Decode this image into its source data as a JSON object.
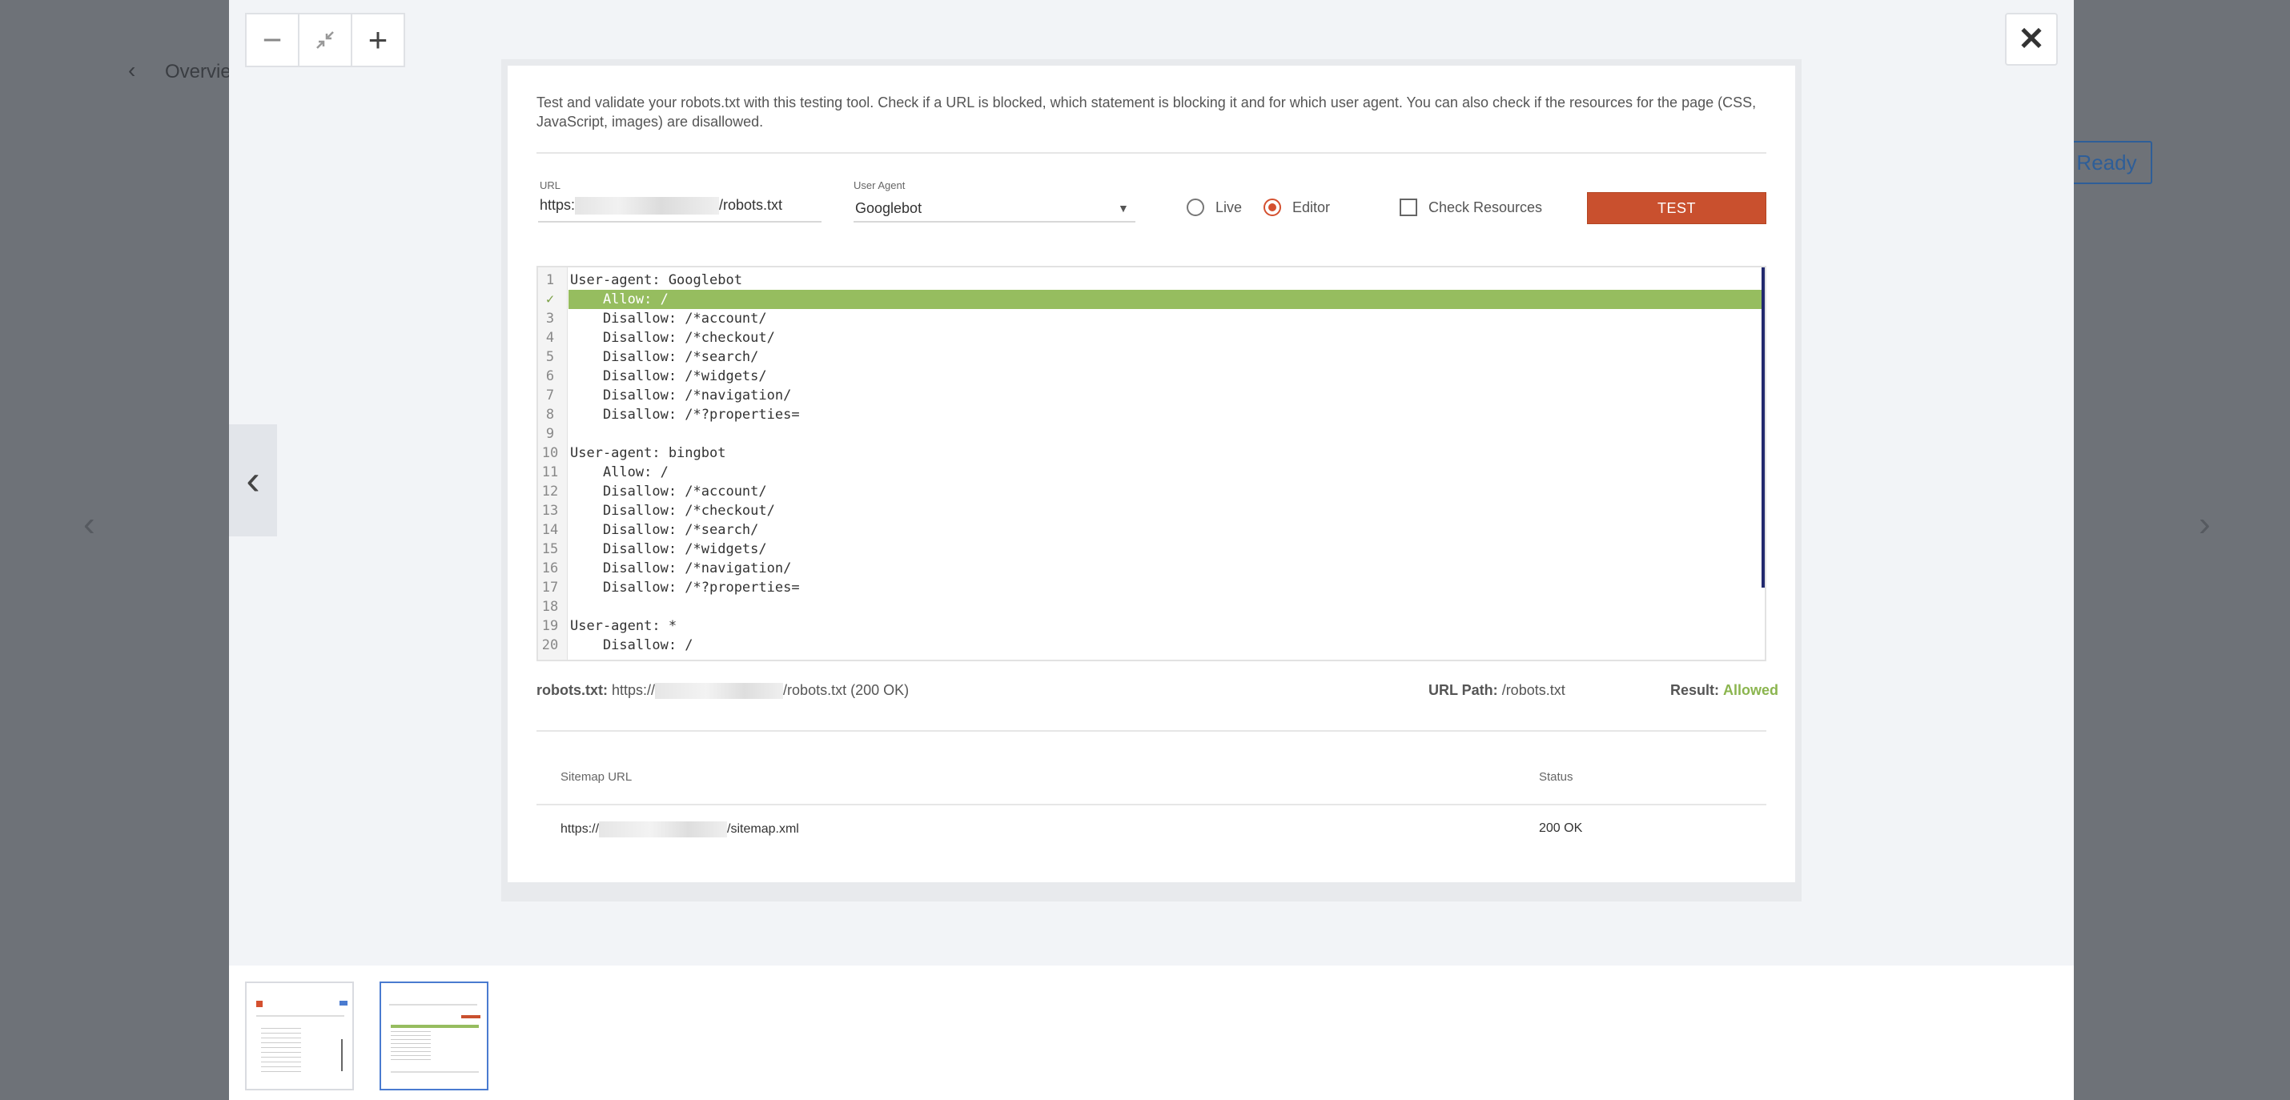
{
  "background": {
    "back_label": "Overvie",
    "status_badge": "Ready"
  },
  "toolbar": {
    "zoom_out_icon": "minus-icon",
    "fit_icon": "compress-icon",
    "zoom_in_icon": "plus-icon",
    "close_icon": "close-icon",
    "prev_icon": "chevron-left-icon"
  },
  "tool": {
    "description": "Test and validate your robots.txt with this testing tool. Check if a URL is blocked, which statement is blocking it and for which user agent. You can also check if the resources for the page (CSS, JavaScript, images) are disallowed.",
    "url_label": "URL",
    "url_prefix": "https:",
    "url_suffix": "/robots.txt",
    "user_agent_label": "User Agent",
    "user_agent_value": "Googlebot",
    "live_label": "Live",
    "editor_label": "Editor",
    "selected_mode": "Editor",
    "check_resources_label": "Check Resources",
    "check_resources_checked": false,
    "test_button": "TEST",
    "accent_color": "#c9502e",
    "allowed_color": "#8bb54f"
  },
  "editor_lines": [
    {
      "n": "1",
      "code": "User-agent: Googlebot"
    },
    {
      "n": "✓",
      "code": "    Allow: /",
      "highlight": true
    },
    {
      "n": "3",
      "code": "    Disallow: /*account/"
    },
    {
      "n": "4",
      "code": "    Disallow: /*checkout/"
    },
    {
      "n": "5",
      "code": "    Disallow: /*search/"
    },
    {
      "n": "6",
      "code": "    Disallow: /*widgets/"
    },
    {
      "n": "7",
      "code": "    Disallow: /*navigation/"
    },
    {
      "n": "8",
      "code": "    Disallow: /*?properties="
    },
    {
      "n": "9",
      "code": ""
    },
    {
      "n": "10",
      "code": "User-agent: bingbot"
    },
    {
      "n": "11",
      "code": "    Allow: /"
    },
    {
      "n": "12",
      "code": "    Disallow: /*account/"
    },
    {
      "n": "13",
      "code": "    Disallow: /*checkout/"
    },
    {
      "n": "14",
      "code": "    Disallow: /*search/"
    },
    {
      "n": "15",
      "code": "    Disallow: /*widgets/"
    },
    {
      "n": "16",
      "code": "    Disallow: /*navigation/"
    },
    {
      "n": "17",
      "code": "    Disallow: /*?properties="
    },
    {
      "n": "18",
      "code": ""
    },
    {
      "n": "19",
      "code": "User-agent: *"
    },
    {
      "n": "20",
      "code": "    Disallow: /"
    }
  ],
  "results": {
    "robots_label": "robots.txt:",
    "robots_prefix": "https://",
    "robots_suffix": "/robots.txt (200 OK)",
    "url_path_label": "URL Path:",
    "url_path_value": "/robots.txt",
    "result_label": "Result:",
    "result_value": "Allowed"
  },
  "sitemap_table": {
    "headers": [
      "Sitemap URL",
      "Status"
    ],
    "rows": [
      {
        "url_prefix": "https://",
        "url_suffix": "/sitemap.xml",
        "status": "200 OK"
      }
    ]
  }
}
